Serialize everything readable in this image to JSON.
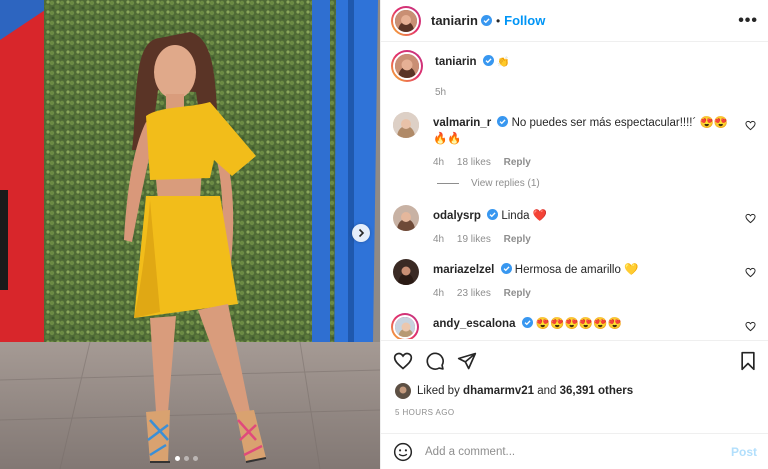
{
  "post": {
    "author": "taniarin",
    "follow_label": "Follow",
    "more_label": "•••",
    "caption_emoji": "👏",
    "caption_time": "5h"
  },
  "comments": [
    {
      "user": "valmarin_r",
      "text": "No puedes ser más espectacular!!!!´ 😍😍🔥🔥",
      "time": "4h",
      "likes": "18 likes",
      "reply": "Reply",
      "view_replies": "View replies (1)"
    },
    {
      "user": "odalysrp",
      "text": "Linda ❤️",
      "time": "4h",
      "likes": "19 likes",
      "reply": "Reply"
    },
    {
      "user": "mariazelzel",
      "text": "Hermosa de amarillo 💛",
      "time": "4h",
      "likes": "23 likes",
      "reply": "Reply"
    },
    {
      "user": "andy_escalona",
      "text": "😍😍😍😍😍😍"
    }
  ],
  "likes": {
    "prefix": "Liked by",
    "user": "dhamarmv21",
    "joiner": "and",
    "count": "36,391 others"
  },
  "timestamp": "5 HOURS AGO",
  "comment_box": {
    "placeholder": "Add a comment...",
    "post_label": "Post"
  },
  "icons": {
    "like": "heart-icon",
    "comment": "comment-bubble-icon",
    "share": "paper-plane-icon",
    "save": "bookmark-icon",
    "emoji": "smiley-icon",
    "carousel_next": "chevron-right-icon"
  },
  "colors": {
    "link_blue": "#0095f6",
    "post_disabled": "#b2dffc",
    "verified_blue": "#3897f0",
    "text_primary": "#262626",
    "text_secondary": "#8e8e8e",
    "outfit_yellow": "#f2bd1a"
  },
  "carousel": {
    "current": 1,
    "total": 3
  }
}
